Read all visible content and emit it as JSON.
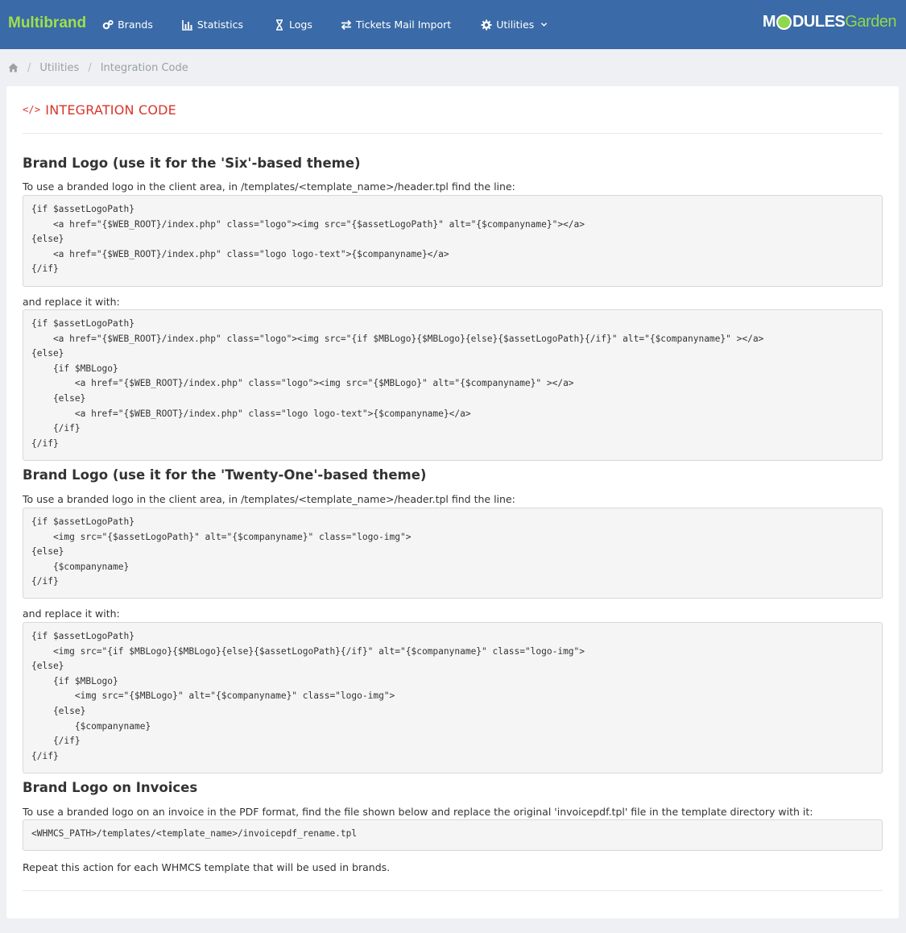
{
  "app": {
    "brand": "Multibrand",
    "logo_left": "M",
    "logo_mid": "DULES",
    "logo_right": "Garden"
  },
  "nav": {
    "brands": "Brands",
    "statistics": "Statistics",
    "logs": "Logs",
    "tickets": "Tickets Mail Import",
    "utilities": "Utilities"
  },
  "breadcrumb": {
    "sep": "/",
    "utilities": "Utilities",
    "current": "Integration Code"
  },
  "panel": {
    "title": "INTEGRATION CODE",
    "icon": "</>"
  },
  "six": {
    "heading": "Brand Logo (use it for the 'Six'-based theme)",
    "find_text": "To use a branded logo in the client area, in /templates/<template_name>/header.tpl find the line:",
    "find_code": "{if $assetLogoPath}\n    <a href=\"{$WEB_ROOT}/index.php\" class=\"logo\"><img src=\"{$assetLogoPath}\" alt=\"{$companyname}\"></a>\n{else}\n    <a href=\"{$WEB_ROOT}/index.php\" class=\"logo logo-text\">{$companyname}</a>\n{/if}",
    "replace_text": "and replace it with:",
    "replace_code": "{if $assetLogoPath}\n    <a href=\"{$WEB_ROOT}/index.php\" class=\"logo\"><img src=\"{if $MBLogo}{$MBLogo}{else}{$assetLogoPath}{/if}\" alt=\"{$companyname}\" ></a>\n{else}\n    {if $MBLogo}\n        <a href=\"{$WEB_ROOT}/index.php\" class=\"logo\"><img src=\"{$MBLogo}\" alt=\"{$companyname}\" ></a>\n    {else}\n        <a href=\"{$WEB_ROOT}/index.php\" class=\"logo logo-text\">{$companyname}</a>\n    {/if}\n{/if}"
  },
  "twentyone": {
    "heading": "Brand Logo (use it for the 'Twenty-One'-based theme)",
    "find_text": "To use a branded logo in the client area, in /templates/<template_name>/header.tpl find the line:",
    "find_code": "{if $assetLogoPath}\n    <img src=\"{$assetLogoPath}\" alt=\"{$companyname}\" class=\"logo-img\">\n{else}\n    {$companyname}\n{/if}",
    "replace_text": "and replace it with:",
    "replace_code": "{if $assetLogoPath}\n    <img src=\"{if $MBLogo}{$MBLogo}{else}{$assetLogoPath}{/if}\" alt=\"{$companyname}\" class=\"logo-img\">\n{else}\n    {if $MBLogo}\n        <img src=\"{$MBLogo}\" alt=\"{$companyname}\" class=\"logo-img\">\n    {else}\n        {$companyname}\n    {/if}\n{/if}"
  },
  "invoices": {
    "heading": "Brand Logo on Invoices",
    "text": "To use a branded logo on an invoice in the PDF format, find the file shown below and replace the original 'invoicepdf.tpl' file in the template directory with it:",
    "code": "<WHMCS_PATH>/templates/<template_name>/invoicepdf_rename.tpl",
    "repeat_text": "Repeat this action for each WHMCS template that will be used in brands."
  },
  "colors": {
    "topbar": "#3a6aa7",
    "brand": "#9ee04a",
    "title": "#d9352a"
  }
}
